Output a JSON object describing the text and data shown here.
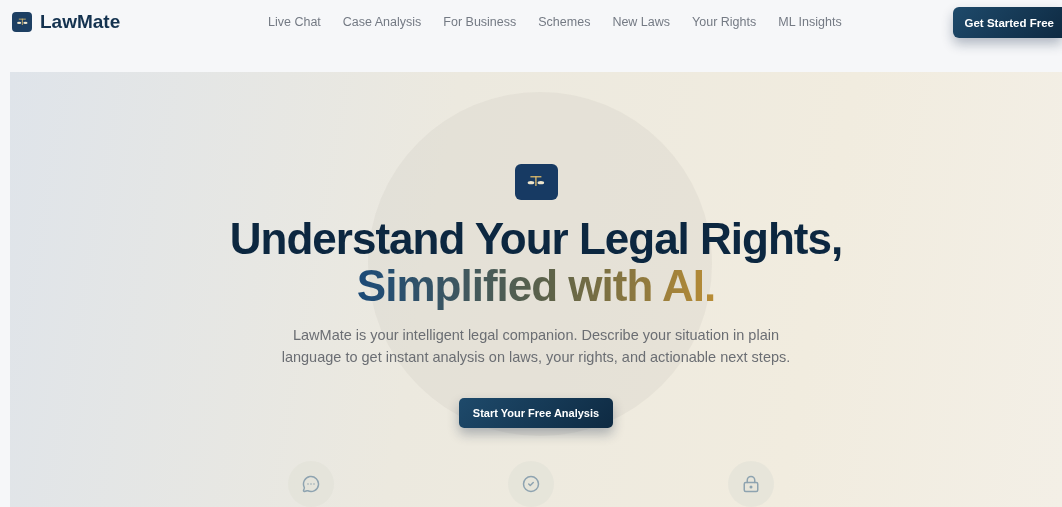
{
  "brand": {
    "name": "LawMate"
  },
  "nav": [
    {
      "label": "Live Chat"
    },
    {
      "label": "Case Analysis"
    },
    {
      "label": "For Business"
    },
    {
      "label": "Schemes"
    },
    {
      "label": "New Laws"
    },
    {
      "label": "Your Rights"
    },
    {
      "label": "ML Insights"
    }
  ],
  "header_button": "Get Started Free",
  "hero": {
    "heading": "Understand Your Legal Rights,",
    "heading_highlight": "Simplified with AI.",
    "description": "LawMate is your intelligent legal companion. Describe your situation in plain language to get instant analysis on laws, your rights, and actionable next steps.",
    "button": "Start Your Free Analysis",
    "features": [
      {
        "kind": "chat"
      },
      {
        "kind": "check"
      },
      {
        "kind": "lock"
      }
    ]
  }
}
